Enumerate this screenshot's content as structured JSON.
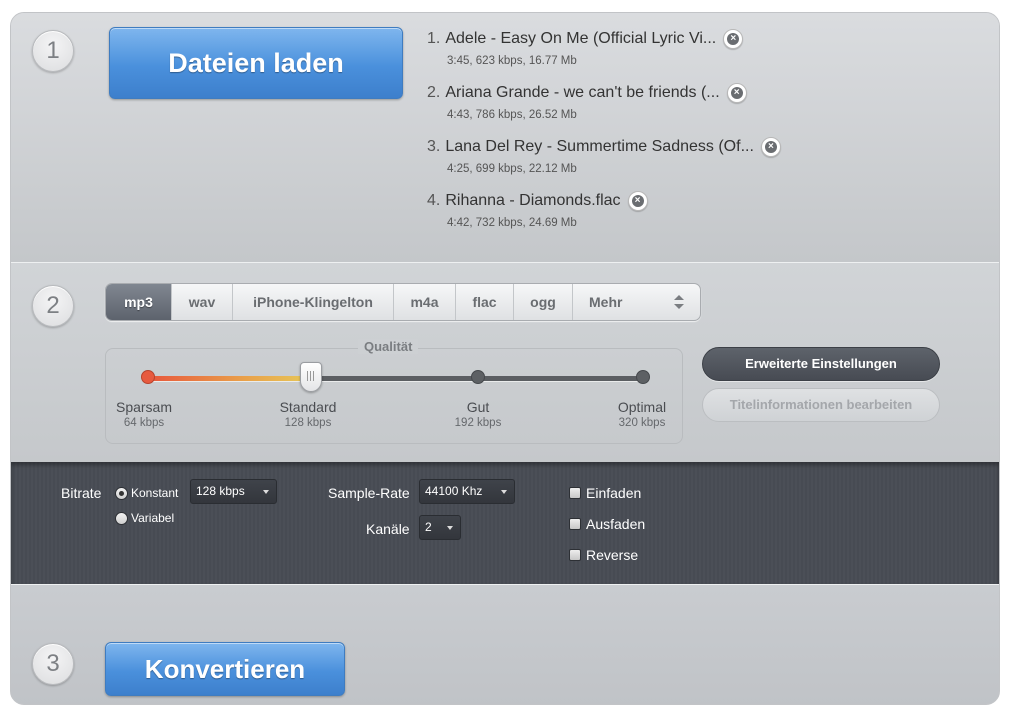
{
  "step1": {
    "number": "1",
    "load_button": "Dateien laden",
    "files": [
      {
        "index": "1.",
        "title": "Adele - Easy On Me (Official Lyric Vi...",
        "meta": "3:45, 623 kbps, 16.77 Mb"
      },
      {
        "index": "2.",
        "title": "Ariana Grande - we can't be friends (...",
        "meta": "4:43, 786 kbps, 26.52 Mb"
      },
      {
        "index": "3.",
        "title": "Lana Del Rey - Summertime Sadness (Of...",
        "meta": "4:25, 699 kbps, 22.12 Mb"
      },
      {
        "index": "4.",
        "title": "Rihanna - Diamonds.flac",
        "meta": "4:42, 732 kbps, 24.69 Mb"
      }
    ]
  },
  "step2": {
    "number": "2",
    "formats": [
      "mp3",
      "wav",
      "iPhone-Klingelton",
      "m4a",
      "flac",
      "ogg",
      "Mehr"
    ],
    "selected_format": "mp3",
    "quality": {
      "title": "Qualität",
      "selected_fraction": 0.333,
      "stops": [
        {
          "label": "Sparsam",
          "sub": "64 kbps"
        },
        {
          "label": "Standard",
          "sub": "128 kbps"
        },
        {
          "label": "Gut",
          "sub": "192 kbps"
        },
        {
          "label": "Optimal",
          "sub": "320 kbps"
        }
      ]
    },
    "advanced_button": "Erweiterte Einstellungen",
    "title_info_button": "Titelinformationen bearbeiten"
  },
  "advanced": {
    "bitrate_label": "Bitrate",
    "bitrate_mode_constant": "Konstant",
    "bitrate_mode_variable": "Variabel",
    "bitrate_value": "128 kbps",
    "sample_rate_label": "Sample-Rate",
    "sample_rate_value": "44100 Khz",
    "channels_label": "Kanäle",
    "channels_value": "2",
    "fade_in": "Einfaden",
    "fade_out": "Ausfaden",
    "reverse": "Reverse"
  },
  "step3": {
    "number": "3",
    "convert_button": "Konvertieren"
  },
  "colors": {
    "accent_blue": "#4a90dc",
    "dark_panel": "#4b4f57",
    "quality_start": "#e7553c"
  }
}
